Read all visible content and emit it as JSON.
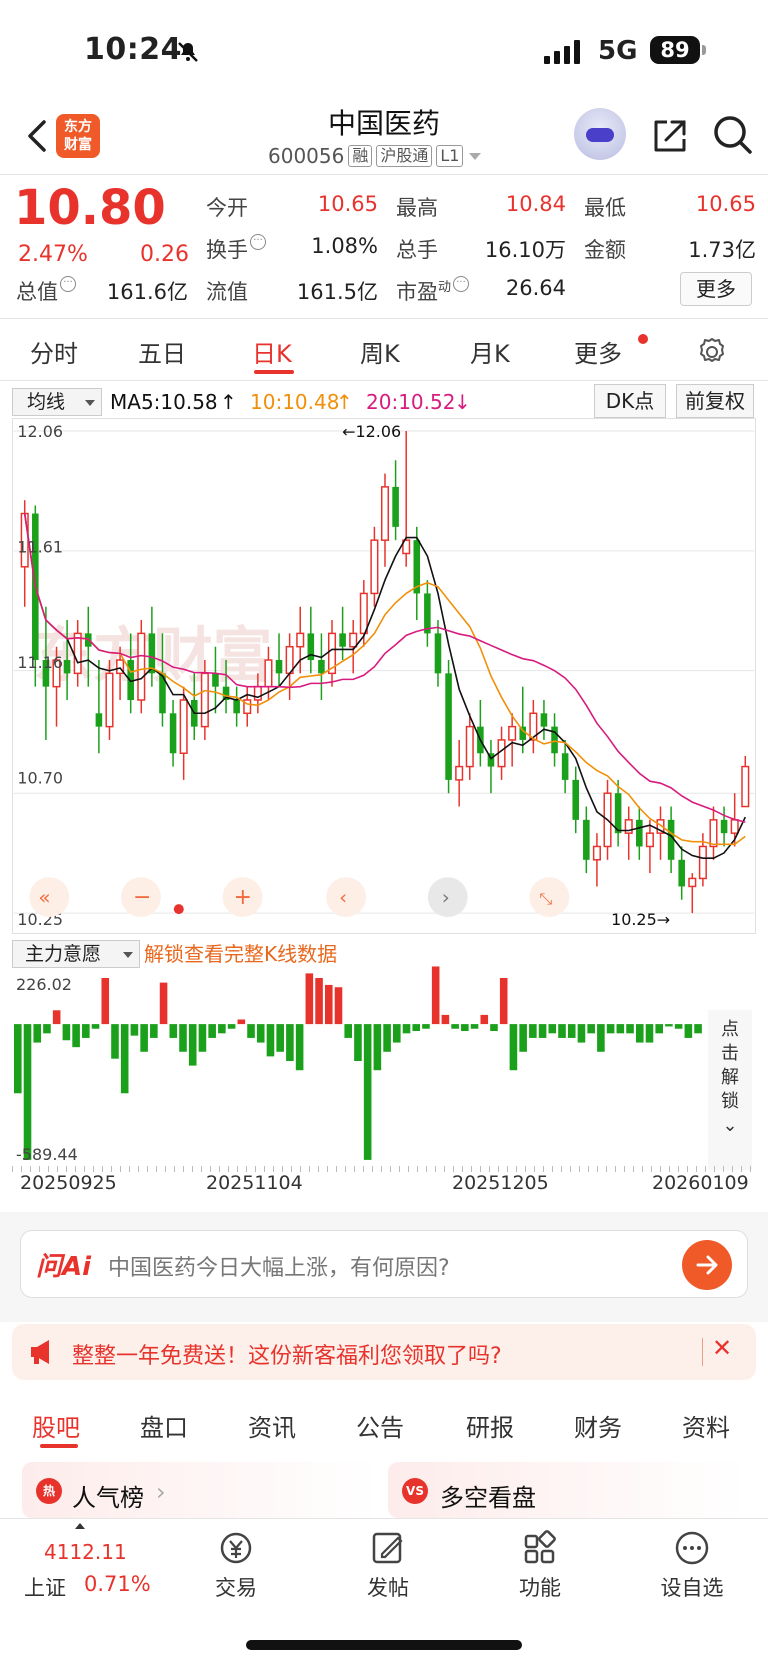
{
  "status": {
    "time": "10:24",
    "network": "5G",
    "battery": "89"
  },
  "header": {
    "logo_line1": "东方",
    "logo_line2": "财富",
    "stock_name": "中国医药",
    "code": "600056",
    "tags": [
      "融",
      "沪股通",
      "L1"
    ]
  },
  "quote": {
    "price": "10.80",
    "pct": "2.47%",
    "chg": "0.26",
    "fields": [
      {
        "label": "今开",
        "value": "10.65",
        "color": "red"
      },
      {
        "label": "最高",
        "value": "10.84",
        "color": "red"
      },
      {
        "label": "最低",
        "value": "10.65",
        "color": "red"
      },
      {
        "label": "换手",
        "value": "1.08%",
        "color": "black"
      },
      {
        "label": "总手",
        "value": "16.10万",
        "color": "black"
      },
      {
        "label": "金额",
        "value": "1.73亿",
        "color": "black"
      },
      {
        "label": "总值",
        "value": "161.6亿",
        "color": "black"
      },
      {
        "label": "流值",
        "value": "161.5亿",
        "color": "black"
      },
      {
        "label": "市盈",
        "value": "26.64",
        "color": "black"
      }
    ],
    "pe_sup": "动",
    "more": "更多"
  },
  "period_tabs": [
    "分时",
    "五日",
    "日K",
    "周K",
    "月K",
    "更多"
  ],
  "ma": {
    "select": "均线",
    "ma5": "MA5:10.58",
    "ma10": "10:10.48",
    "ma20": "20:10.52",
    "dk": "DK点",
    "adjust": "前复权"
  },
  "kline": {
    "y_labels": [
      "12.06",
      "11.61",
      "11.16",
      "10.70",
      "10.25"
    ],
    "high_marker": "←12.06",
    "low_marker": "10.25→"
  },
  "volume": {
    "select": "主力意愿",
    "unlock_link": "解锁查看完整K线数据",
    "max_label": "226.02",
    "min_label": "-589.44",
    "side_unlock": [
      "点",
      "击",
      "解",
      "锁"
    ],
    "dates": [
      "20250925",
      "20251104",
      "20251205",
      "20260109"
    ]
  },
  "ai": {
    "logo": "问Ai",
    "question": "中国医药今日大幅上涨，有何原因?"
  },
  "promo": {
    "text": "整整一年免费送！这份新客福利您领取了吗?"
  },
  "bottom_tabs": [
    "股吧",
    "盘口",
    "资讯",
    "公告",
    "研报",
    "财务",
    "资料"
  ],
  "cards": [
    {
      "icon": "热",
      "title": "人气榜"
    },
    {
      "icon": "VS",
      "title": "多空看盘"
    }
  ],
  "bottom_nav": {
    "index_value": "4112.11",
    "index_name": "上证",
    "index_pct": "0.71%",
    "items": [
      "交易",
      "发帖",
      "功能",
      "设自选"
    ]
  },
  "colors": {
    "up": "#e8332d",
    "down": "#1aa01a",
    "ma5": "#111111",
    "ma10": "#f0900a",
    "ma20": "#d81b7f",
    "accent": "#f05a28"
  },
  "chart_data": {
    "type": "candlestick",
    "ylim": [
      10.25,
      12.06
    ],
    "y_ticks": [
      12.06,
      11.61,
      11.16,
      10.7,
      10.25
    ],
    "candles": [
      [
        11.55,
        11.8,
        11.4,
        11.75
      ],
      [
        11.75,
        11.78,
        11.1,
        11.2
      ],
      [
        11.2,
        11.4,
        10.9,
        11.1
      ],
      [
        11.1,
        11.25,
        10.95,
        11.2
      ],
      [
        11.2,
        11.35,
        11.05,
        11.15
      ],
      [
        11.15,
        11.35,
        11.1,
        11.3
      ],
      [
        11.3,
        11.4,
        11.1,
        11.25
      ],
      [
        11.0,
        11.2,
        10.85,
        10.95
      ],
      [
        10.95,
        11.2,
        10.9,
        11.15
      ],
      [
        11.15,
        11.25,
        11.05,
        11.2
      ],
      [
        11.2,
        11.3,
        11.0,
        11.05
      ],
      [
        11.05,
        11.35,
        11.0,
        11.3
      ],
      [
        11.3,
        11.4,
        11.1,
        11.15
      ],
      [
        11.15,
        11.3,
        10.95,
        11.0
      ],
      [
        11.0,
        11.05,
        10.8,
        10.85
      ],
      [
        10.85,
        11.1,
        10.75,
        11.05
      ],
      [
        11.05,
        11.15,
        10.9,
        10.95
      ],
      [
        10.95,
        11.2,
        10.9,
        11.15
      ],
      [
        11.15,
        11.25,
        11.0,
        11.1
      ],
      [
        11.1,
        11.2,
        11.0,
        11.05
      ],
      [
        11.05,
        11.1,
        10.95,
        11.0
      ],
      [
        11.0,
        11.1,
        10.95,
        11.05
      ],
      [
        11.05,
        11.15,
        11.0,
        11.1
      ],
      [
        11.1,
        11.25,
        11.05,
        11.2
      ],
      [
        11.2,
        11.3,
        11.1,
        11.15
      ],
      [
        11.15,
        11.3,
        11.05,
        11.25
      ],
      [
        11.25,
        11.4,
        11.15,
        11.3
      ],
      [
        11.3,
        11.4,
        11.15,
        11.2
      ],
      [
        11.2,
        11.3,
        11.05,
        11.15
      ],
      [
        11.15,
        11.35,
        11.1,
        11.3
      ],
      [
        11.3,
        11.4,
        11.2,
        11.25
      ],
      [
        11.25,
        11.35,
        11.15,
        11.3
      ],
      [
        11.3,
        11.5,
        11.25,
        11.45
      ],
      [
        11.45,
        11.7,
        11.4,
        11.65
      ],
      [
        11.65,
        11.9,
        11.55,
        11.85
      ],
      [
        11.85,
        11.95,
        11.65,
        11.7
      ],
      [
        11.6,
        12.06,
        11.55,
        11.65
      ],
      [
        11.65,
        11.7,
        11.35,
        11.45
      ],
      [
        11.45,
        11.5,
        11.25,
        11.3
      ],
      [
        11.3,
        11.35,
        11.1,
        11.15
      ],
      [
        11.15,
        11.2,
        10.7,
        10.75
      ],
      [
        10.75,
        10.9,
        10.65,
        10.8
      ],
      [
        10.8,
        11.0,
        10.75,
        10.95
      ],
      [
        10.95,
        11.05,
        10.8,
        10.85
      ],
      [
        10.85,
        10.9,
        10.7,
        10.8
      ],
      [
        10.8,
        10.95,
        10.75,
        10.9
      ],
      [
        10.9,
        11.0,
        10.8,
        10.95
      ],
      [
        10.95,
        11.1,
        10.85,
        10.9
      ],
      [
        10.9,
        11.05,
        10.85,
        11.0
      ],
      [
        11.0,
        11.05,
        10.9,
        10.95
      ],
      [
        10.95,
        11.0,
        10.8,
        10.85
      ],
      [
        10.85,
        10.9,
        10.7,
        10.75
      ],
      [
        10.75,
        10.8,
        10.55,
        10.6
      ],
      [
        10.6,
        10.65,
        10.4,
        10.45
      ],
      [
        10.45,
        10.55,
        10.35,
        10.5
      ],
      [
        10.5,
        10.75,
        10.45,
        10.7
      ],
      [
        10.7,
        10.75,
        10.5,
        10.55
      ],
      [
        10.55,
        10.65,
        10.45,
        10.6
      ],
      [
        10.6,
        10.65,
        10.45,
        10.5
      ],
      [
        10.5,
        10.6,
        10.4,
        10.55
      ],
      [
        10.55,
        10.65,
        10.45,
        10.6
      ],
      [
        10.6,
        10.65,
        10.4,
        10.45
      ],
      [
        10.45,
        10.5,
        10.3,
        10.35
      ],
      [
        10.35,
        10.4,
        10.25,
        10.38
      ],
      [
        10.38,
        10.55,
        10.35,
        10.5
      ],
      [
        10.5,
        10.65,
        10.45,
        10.6
      ],
      [
        10.6,
        10.65,
        10.5,
        10.55
      ],
      [
        10.55,
        10.7,
        10.5,
        10.6
      ],
      [
        10.65,
        10.84,
        10.65,
        10.8
      ]
    ],
    "ma_series": [
      {
        "name": "MA5",
        "last": 10.58
      },
      {
        "name": "MA10",
        "last": 10.48
      },
      {
        "name": "MA20",
        "last": 10.52
      }
    ],
    "volume_series": {
      "name": "主力意愿",
      "ylim": [
        -589.44,
        226.02
      ],
      "values": [
        -300,
        -589,
        -80,
        -40,
        60,
        -70,
        -100,
        -60,
        -20,
        200,
        -150,
        -300,
        -50,
        -120,
        -60,
        180,
        -60,
        -120,
        -180,
        -120,
        -60,
        -40,
        -20,
        20,
        -60,
        -80,
        -140,
        -120,
        -160,
        -200,
        220,
        200,
        170,
        160,
        -60,
        -160,
        -589,
        -200,
        -120,
        -80,
        -40,
        -30,
        -20,
        250,
        40,
        -20,
        -30,
        -20,
        40,
        -30,
        200,
        -200,
        -120,
        -60,
        -60,
        -40,
        -60,
        -60,
        -80,
        -40,
        -120,
        -40,
        -40,
        -40,
        -80,
        -80,
        -40,
        -10,
        -20,
        -60,
        -40
      ]
    }
  }
}
